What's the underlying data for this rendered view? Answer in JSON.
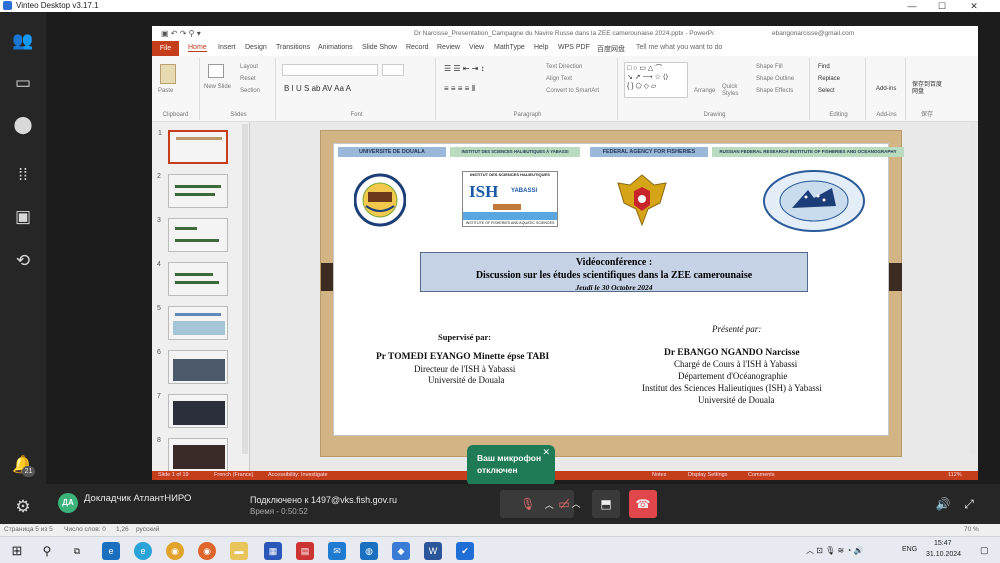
{
  "window": {
    "title": "Vinteo Desktop v3.17.1"
  },
  "ppt": {
    "filename": "Dr Narcisse_Presentation_Campagne du Navire Russe dans la ZEE camerounaise 2024.pptx  -  PowerPoint",
    "email": "ebangonarcisse@gmail.com",
    "tabs": [
      "File",
      "Home",
      "Insert",
      "Design",
      "Transitions",
      "Animations",
      "Slide Show",
      "Record",
      "Review",
      "View",
      "MathType",
      "Help",
      "WPS PDF",
      "百度网盘",
      "Tell me what you want to do"
    ],
    "ribbon": {
      "paste": "Paste",
      "new_slide": "New Slide",
      "layout": "Layout",
      "reset": "Reset",
      "section": "Section",
      "text_direction": "Text Direction",
      "align_text": "Align Text",
      "smartart": "Convert to SmartArt",
      "shape_fill": "Shape Fill",
      "shape_outline": "Shape Outline",
      "shape_effects": "Shape Effects",
      "arrange": "Arrange",
      "quick_styles": "Quick Styles",
      "find": "Find",
      "replace": "Replace",
      "select": "Select",
      "addins": "Add-ins",
      "addins2": "Add-ins",
      "baidu": "保存到百度网盘",
      "groups": [
        "Clipboard",
        "Slides",
        "Font",
        "Paragraph",
        "Drawing",
        "Editing",
        "Add-ins",
        "保存"
      ]
    },
    "status": {
      "slide": "Slide 1 of 19",
      "lang": "French (France)",
      "access": "Accessibility: Investigate",
      "notes": "Notes",
      "display": "Display Settings",
      "comments": "Comments",
      "zoom": "112%"
    }
  },
  "slide": {
    "bars": [
      "UNIVERSITE DE DOUALA",
      "INSTITUT DES SCIENCES HALIEUTIQUES  À YABASSI",
      "FEDERAL AGENCY FOR FISHERIES",
      "RUSSIAN FEDERAL RESEARCH INSTITUTE OF FISHERIES AND OCEANOGRAPHY"
    ],
    "ish_top": "INSTITUT DES SCIENCES HALIEUTIQUES",
    "ish_logo": "ISH",
    "ish_city": "YABASSI",
    "ish_bottom": "INSTITUTE OF FISHERIES AND AQUATIC SCIENCES",
    "title1": "Vidéoconférence  :",
    "title2": "Discussion sur les études scientifiques dans la ZEE camerounaise",
    "date": "Jeudi le 30 Octobre 2024",
    "sup_head": "Supervisé par:",
    "sup_name": "Pr TOMEDI EYANGO Minette épse TABI",
    "sup_r1": "Directeur de l'ISH à Yabassi",
    "sup_r2": "Université de Douala",
    "pres_head": "Présenté par:",
    "pres_name": "Dr EBANGO NGANDO Narcisse",
    "pres_r1": "Chargé de Cours à l'ISH à Yabassi",
    "pres_r2": "Département d'Océanographie",
    "pres_r3": "Institut des Sciences Halieutiques (ISH) à Yabassi",
    "pres_r4": "Université de Douala"
  },
  "thumbs": [
    "1",
    "2",
    "3",
    "4",
    "5",
    "6",
    "7",
    "8"
  ],
  "toast": {
    "line1": "Ваш микрофон",
    "line2": "отключен"
  },
  "call": {
    "initials": "ДА",
    "name": "Докладчик АтлантНИРО",
    "connected": "Подключено к 1497@vks.fish.gov.ru",
    "time": "Время - 0:50:52"
  },
  "rail": {
    "badge": "21"
  },
  "word_status": {
    "page": "Страница 5 из 5",
    "words": "Число слов: 0",
    "dim": "1,26",
    "lang": "русский",
    "zoom": "70 %"
  },
  "taskbar": {
    "lang": "ENG",
    "time": "15:47",
    "date": "31.10.2024"
  }
}
